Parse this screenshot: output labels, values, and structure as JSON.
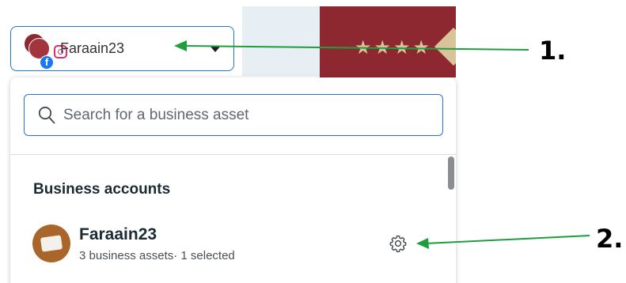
{
  "account_selector": {
    "name": "Faraain23",
    "icons": [
      "instagram-icon",
      "facebook-icon",
      "chevron-down-icon"
    ],
    "fb_letter": "f"
  },
  "search": {
    "placeholder": "Search for a business asset",
    "value": ""
  },
  "section": {
    "heading": "Business accounts"
  },
  "business_account": {
    "name": "Faraain23",
    "subtitle": "3 business assets· 1 selected",
    "icon": "gear-icon"
  },
  "background": {
    "stars": "★★★★"
  },
  "annotations": {
    "label_1": "1.",
    "label_2": "2.",
    "arrow_color": "#1e9e3e"
  },
  "colors": {
    "accent_blue": "#2a73c9",
    "brand_red": "#8e2830",
    "facebook_blue": "#1877f2"
  }
}
